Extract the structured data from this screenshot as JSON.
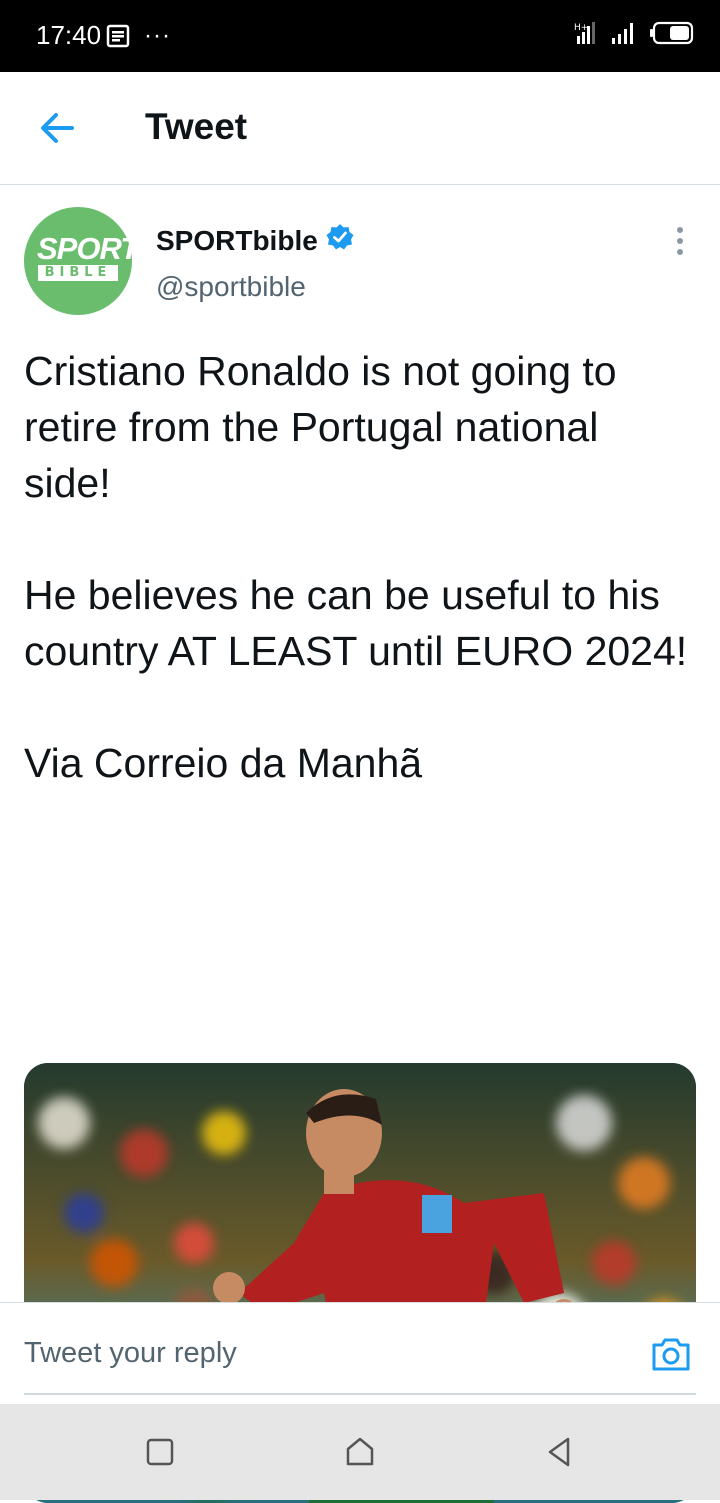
{
  "status_bar": {
    "time": "17:40",
    "more": "···"
  },
  "header": {
    "title": "Tweet"
  },
  "tweet": {
    "display_name": "SPORTbible",
    "handle": "@sportbible",
    "avatar_top": "SPORT",
    "avatar_bottom": "BIBLE",
    "text": "Cristiano Ronaldo is not going to retire from the Portugal national side!\n\nHe believes he can be useful to his country AT LEAST until EURO 2024!\n\nVia Correio da Manhã"
  },
  "reply": {
    "placeholder": "Tweet your reply"
  },
  "colors": {
    "accent": "#1d9bf0",
    "avatar_green": "#6bbd6e",
    "text": "#0f1419",
    "muted": "#536471"
  }
}
